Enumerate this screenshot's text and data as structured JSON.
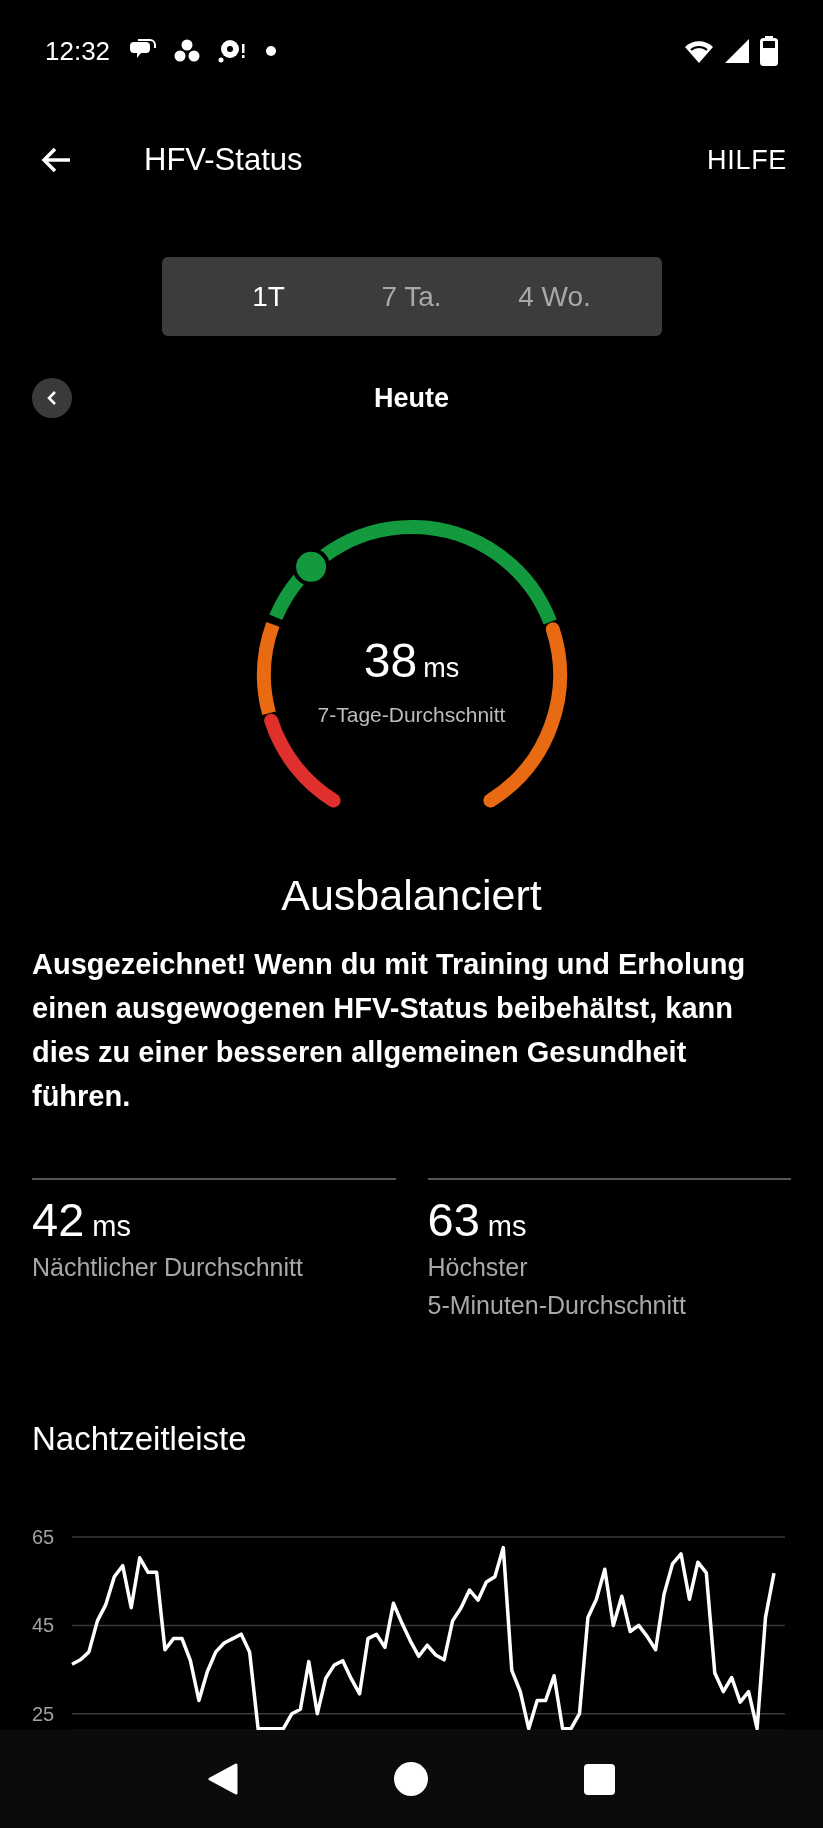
{
  "status_bar": {
    "time": "12:32"
  },
  "header": {
    "title": "HFV-Status",
    "help": "HILFE"
  },
  "range_tabs": [
    {
      "label": "1T",
      "selected": true
    },
    {
      "label": "7 Ta.",
      "selected": false
    },
    {
      "label": "4 Wo.",
      "selected": false
    }
  ],
  "period": {
    "label": "Heute"
  },
  "gauge": {
    "value": "38",
    "unit": "ms",
    "caption": "7-Tage-Durchschnitt"
  },
  "status_title": "Ausbalanciert",
  "description": "Ausgezeichnet! Wenn du mit Training und Erholung einen ausgewogenen HFV-Status beibehältst, kann dies zu einer besseren allgemeinen Gesundheit führen.",
  "stats": [
    {
      "value": "42",
      "unit": "ms",
      "label": "Nächtlicher Durchschnitt"
    },
    {
      "value": "63",
      "unit": "ms",
      "label": "Höchster 5-Minuten-Durchschnitt"
    }
  ],
  "timeline": {
    "title": "Nachtzeitleiste",
    "chart_data": {
      "type": "line",
      "ylim": [
        21.2,
        65
      ],
      "yticks": [
        25,
        45,
        65
      ],
      "series": [
        {
          "color": "#ffffff",
          "values": [
            36.2,
            37.2,
            39,
            46,
            49.7,
            56,
            58.5,
            49,
            60.3,
            57,
            57,
            39.5,
            42,
            42,
            37,
            28,
            34.5,
            39,
            41,
            42,
            43,
            39,
            21.6,
            21.6,
            21.6,
            21.6,
            25,
            26,
            36.8,
            25,
            33,
            36,
            37,
            33,
            29.5,
            42,
            43,
            40,
            50,
            45.5,
            41.5,
            38,
            40.5,
            38.3,
            37.2,
            46,
            49,
            53,
            50.7,
            54.8,
            56,
            62.6,
            34.8,
            30,
            21.6,
            28,
            28,
            33.6,
            21.6,
            21.6,
            25,
            46.8,
            50.9,
            57.7,
            45,
            51.6,
            43.6,
            45,
            42.5,
            39.5,
            52,
            58.9,
            61.2,
            50.9,
            59.3,
            56.9,
            34.2,
            30,
            33.2,
            27.6,
            30,
            21.6,
            46.8,
            56.8
          ]
        }
      ]
    }
  }
}
